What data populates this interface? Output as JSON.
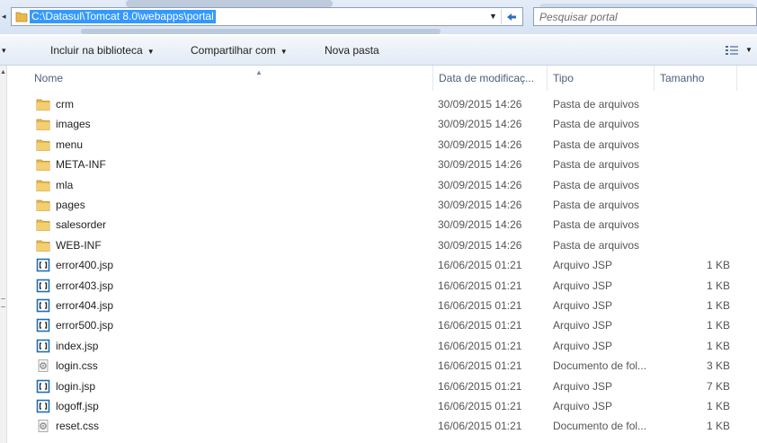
{
  "address_bar": {
    "path": "C:\\Datasul\\Tomcat 8.0\\webapps\\portal",
    "search_placeholder": "Pesquisar portal"
  },
  "toolbar": {
    "items": [
      {
        "label": "Incluir na biblioteca",
        "has_dropdown": true
      },
      {
        "label": "Compartilhar com",
        "has_dropdown": true
      },
      {
        "label": "Nova pasta",
        "has_dropdown": false
      }
    ]
  },
  "columns": {
    "name": "Nome",
    "date": "Data de modificaç...",
    "type": "Tipo",
    "size": "Tamanho"
  },
  "files": [
    {
      "name": "crm",
      "date": "30/09/2015 14:26",
      "type": "Pasta de arquivos",
      "size": "",
      "icon": "folder-icon"
    },
    {
      "name": "images",
      "date": "30/09/2015 14:26",
      "type": "Pasta de arquivos",
      "size": "",
      "icon": "folder-icon"
    },
    {
      "name": "menu",
      "date": "30/09/2015 14:26",
      "type": "Pasta de arquivos",
      "size": "",
      "icon": "folder-icon"
    },
    {
      "name": "META-INF",
      "date": "30/09/2015 14:26",
      "type": "Pasta de arquivos",
      "size": "",
      "icon": "folder-icon"
    },
    {
      "name": "mla",
      "date": "30/09/2015 14:26",
      "type": "Pasta de arquivos",
      "size": "",
      "icon": "folder-icon"
    },
    {
      "name": "pages",
      "date": "30/09/2015 14:26",
      "type": "Pasta de arquivos",
      "size": "",
      "icon": "folder-icon"
    },
    {
      "name": "salesorder",
      "date": "30/09/2015 14:26",
      "type": "Pasta de arquivos",
      "size": "",
      "icon": "folder-icon"
    },
    {
      "name": "WEB-INF",
      "date": "30/09/2015 14:26",
      "type": "Pasta de arquivos",
      "size": "",
      "icon": "folder-icon"
    },
    {
      "name": "error400.jsp",
      "date": "16/06/2015 01:21",
      "type": "Arquivo JSP",
      "size": "1 KB",
      "icon": "jsp-file-icon"
    },
    {
      "name": "error403.jsp",
      "date": "16/06/2015 01:21",
      "type": "Arquivo JSP",
      "size": "1 KB",
      "icon": "jsp-file-icon"
    },
    {
      "name": "error404.jsp",
      "date": "16/06/2015 01:21",
      "type": "Arquivo JSP",
      "size": "1 KB",
      "icon": "jsp-file-icon"
    },
    {
      "name": "error500.jsp",
      "date": "16/06/2015 01:21",
      "type": "Arquivo JSP",
      "size": "1 KB",
      "icon": "jsp-file-icon"
    },
    {
      "name": "index.jsp",
      "date": "16/06/2015 01:21",
      "type": "Arquivo JSP",
      "size": "1 KB",
      "icon": "jsp-file-icon"
    },
    {
      "name": "login.css",
      "date": "16/06/2015 01:21",
      "type": "Documento de fol...",
      "size": "3 KB",
      "icon": "css-file-icon"
    },
    {
      "name": "login.jsp",
      "date": "16/06/2015 01:21",
      "type": "Arquivo JSP",
      "size": "7 KB",
      "icon": "jsp-file-icon"
    },
    {
      "name": "logoff.jsp",
      "date": "16/06/2015 01:21",
      "type": "Arquivo JSP",
      "size": "1 KB",
      "icon": "jsp-file-icon"
    },
    {
      "name": "reset.css",
      "date": "16/06/2015 01:21",
      "type": "Documento de fol...",
      "size": "1 KB",
      "icon": "css-file-icon"
    }
  ],
  "colors": {
    "selection": "#3399ff",
    "folder": "#e8b94a",
    "jsp_icon": "#1f6fb5"
  }
}
